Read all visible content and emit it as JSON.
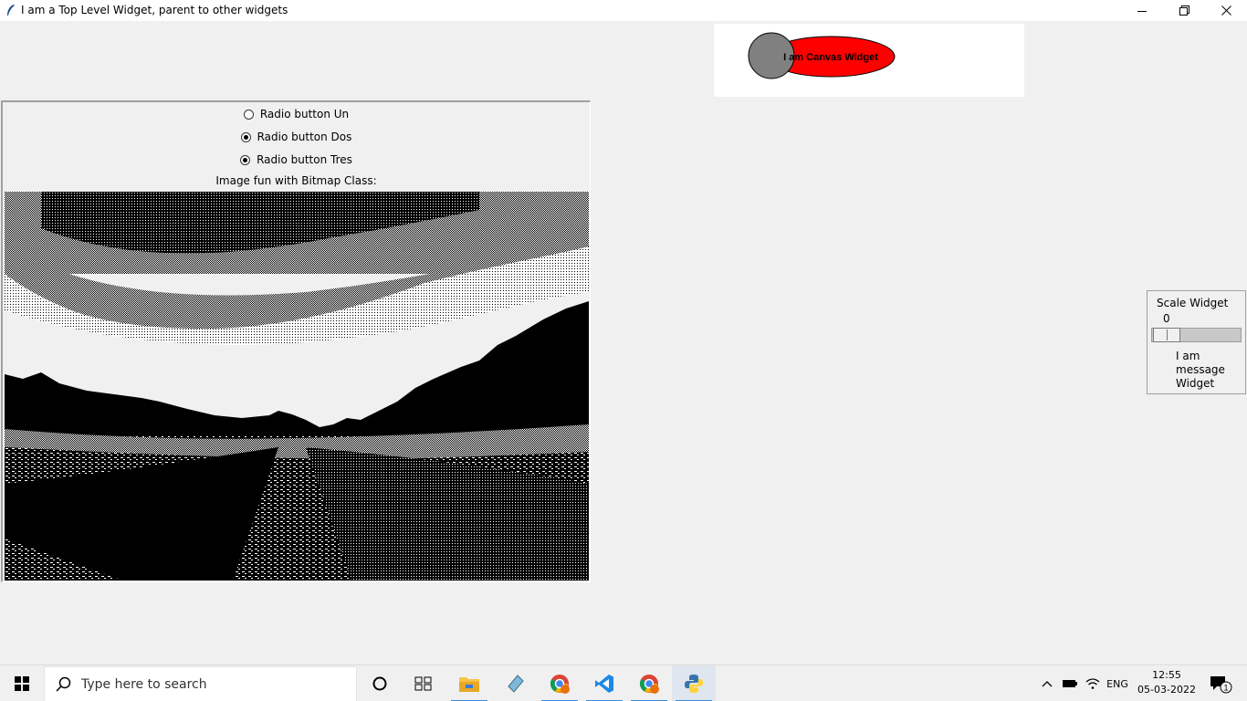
{
  "window": {
    "title": "I am a Top Level Widget, parent to other widgets",
    "buttons": [
      "minimize",
      "restore",
      "close"
    ]
  },
  "canvas": {
    "text": "I am Canvas Widget",
    "colors": {
      "ellipse_fill": "#ff0000",
      "circle_fill": "#808080",
      "background": "#ffffff"
    }
  },
  "radios": [
    {
      "label": "Radio button Un",
      "checked": false
    },
    {
      "label": "Radio button Dos",
      "checked": true
    },
    {
      "label": "Radio button Tres",
      "checked": true
    }
  ],
  "image_label": "Image fun with Bitmap Class:",
  "scale": {
    "title": "Scale Widget",
    "value": "0",
    "message": "I am message Widget"
  },
  "taskbar": {
    "search_placeholder": "Type here to search",
    "apps": [
      "cortana-icon",
      "task-view-icon",
      "file-explorer-icon",
      "notepad-icon",
      "chrome-icon",
      "vscode-icon",
      "chrome-profile-icon",
      "python-icon"
    ],
    "language": "ENG",
    "time": "12:55",
    "date": "05-03-2022",
    "notification_count": "1"
  }
}
